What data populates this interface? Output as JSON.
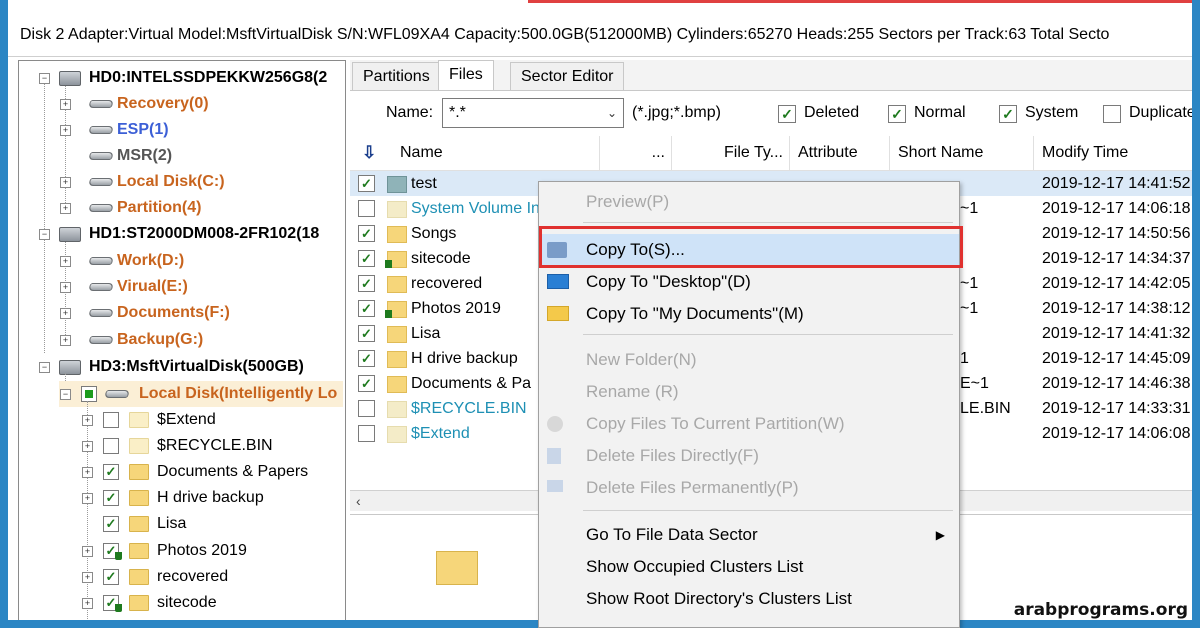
{
  "infobar": "Disk 2 Adapter:Virtual  Model:MsftVirtualDisk  S/N:WFL09XA4  Capacity:500.0GB(512000MB)  Cylinders:65270  Heads:255  Sectors per Track:63  Total Secto",
  "tree": {
    "hd0": "HD0:INTELSSDPEKKW256G8(2",
    "hd0_parts": [
      "Recovery(0)",
      "ESP(1)",
      "MSR(2)",
      "Local Disk(C:)",
      "Partition(4)"
    ],
    "hd1": "HD1:ST2000DM008-2FR102(18",
    "hd1_parts": [
      "Work(D:)",
      "Virual(E:)",
      "Documents(F:)",
      "Backup(G:)"
    ],
    "hd3": "HD3:MsftVirtualDisk(500GB)",
    "hd3_part": "Local Disk(Intelligently Lo",
    "hd3_folders": [
      "$Extend",
      "$RECYCLE.BIN",
      "Documents & Papers",
      "H drive backup",
      "Lisa",
      "Photos 2019",
      "recovered",
      "sitecode"
    ]
  },
  "tabs": [
    "Partitions",
    "Files",
    "Sector Editor"
  ],
  "filter": {
    "name_label": "Name:",
    "name_value": "*.*",
    "ext_hint": "(*.jpg;*.bmp)",
    "deleted": "Deleted",
    "normal": "Normal",
    "system": "System",
    "duplicate": "Duplicate"
  },
  "columns": {
    "name": "Name",
    "size": "...",
    "file_type": "File Ty...",
    "attribute": "Attribute",
    "short_name": "Short Name",
    "modify_time": "Modify Time"
  },
  "rows": [
    {
      "name": "test",
      "short": "",
      "time": "2019-12-17 14:41:52"
    },
    {
      "name": "System Volume In",
      "short": "~1",
      "time": "2019-12-17 14:06:18"
    },
    {
      "name": "Songs",
      "short": "",
      "time": "2019-12-17 14:50:56"
    },
    {
      "name": "sitecode",
      "short": "",
      "time": "2019-12-17 14:34:37"
    },
    {
      "name": "recovered",
      "short": "~1",
      "time": "2019-12-17 14:42:05"
    },
    {
      "name": "Photos 2019",
      "short": "~1",
      "time": "2019-12-17 14:38:12"
    },
    {
      "name": "Lisa",
      "short": "",
      "time": "2019-12-17 14:41:32"
    },
    {
      "name": "H drive backup",
      "short": "1",
      "time": "2019-12-17 14:45:09"
    },
    {
      "name": "Documents & Pa",
      "short": "E~1",
      "time": "2019-12-17 14:46:38"
    },
    {
      "name": "$RECYCLE.BIN",
      "short": "LE.BIN",
      "time": "2019-12-17 14:33:31"
    },
    {
      "name": "$Extend",
      "short": "",
      "time": "2019-12-17 14:06:08"
    }
  ],
  "menu": {
    "preview": "Preview(P)",
    "copy_to": "Copy To(S)...",
    "copy_desktop": "Copy To \"Desktop\"(D)",
    "copy_mydocs": "Copy To \"My Documents\"(M)",
    "new_folder": "New Folder(N)",
    "rename": "Rename (R)",
    "copy_current": "Copy Files To Current Partition(W)",
    "delete_directly": "Delete Files Directly(F)",
    "delete_perm": "Delete Files Permanently(P)",
    "goto_sector": "Go To File Data Sector",
    "occupied": "Show Occupied Clusters List",
    "root_clusters": "Show Root Directory's Clusters List"
  },
  "watermark": "arabprograms.org",
  "colors": {
    "accent_red": "#e0312f",
    "partition_orange": "#c8641e",
    "frame_blue": "#2b86c4"
  }
}
